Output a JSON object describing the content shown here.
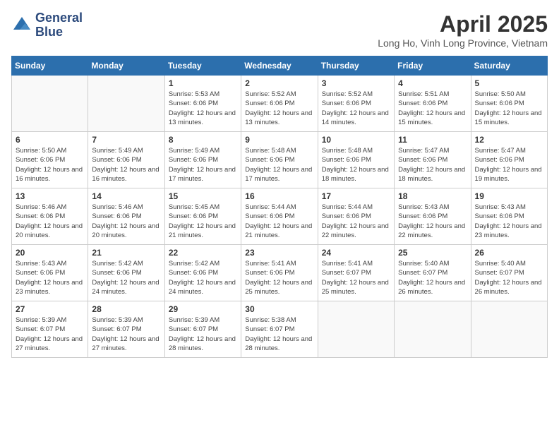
{
  "logo": {
    "line1": "General",
    "line2": "Blue"
  },
  "title": "April 2025",
  "location": "Long Ho, Vinh Long Province, Vietnam",
  "weekdays": [
    "Sunday",
    "Monday",
    "Tuesday",
    "Wednesday",
    "Thursday",
    "Friday",
    "Saturday"
  ],
  "weeks": [
    [
      {
        "day": "",
        "info": ""
      },
      {
        "day": "",
        "info": ""
      },
      {
        "day": "1",
        "info": "Sunrise: 5:53 AM\nSunset: 6:06 PM\nDaylight: 12 hours and 13 minutes."
      },
      {
        "day": "2",
        "info": "Sunrise: 5:52 AM\nSunset: 6:06 PM\nDaylight: 12 hours and 13 minutes."
      },
      {
        "day": "3",
        "info": "Sunrise: 5:52 AM\nSunset: 6:06 PM\nDaylight: 12 hours and 14 minutes."
      },
      {
        "day": "4",
        "info": "Sunrise: 5:51 AM\nSunset: 6:06 PM\nDaylight: 12 hours and 15 minutes."
      },
      {
        "day": "5",
        "info": "Sunrise: 5:50 AM\nSunset: 6:06 PM\nDaylight: 12 hours and 15 minutes."
      }
    ],
    [
      {
        "day": "6",
        "info": "Sunrise: 5:50 AM\nSunset: 6:06 PM\nDaylight: 12 hours and 16 minutes."
      },
      {
        "day": "7",
        "info": "Sunrise: 5:49 AM\nSunset: 6:06 PM\nDaylight: 12 hours and 16 minutes."
      },
      {
        "day": "8",
        "info": "Sunrise: 5:49 AM\nSunset: 6:06 PM\nDaylight: 12 hours and 17 minutes."
      },
      {
        "day": "9",
        "info": "Sunrise: 5:48 AM\nSunset: 6:06 PM\nDaylight: 12 hours and 17 minutes."
      },
      {
        "day": "10",
        "info": "Sunrise: 5:48 AM\nSunset: 6:06 PM\nDaylight: 12 hours and 18 minutes."
      },
      {
        "day": "11",
        "info": "Sunrise: 5:47 AM\nSunset: 6:06 PM\nDaylight: 12 hours and 18 minutes."
      },
      {
        "day": "12",
        "info": "Sunrise: 5:47 AM\nSunset: 6:06 PM\nDaylight: 12 hours and 19 minutes."
      }
    ],
    [
      {
        "day": "13",
        "info": "Sunrise: 5:46 AM\nSunset: 6:06 PM\nDaylight: 12 hours and 20 minutes."
      },
      {
        "day": "14",
        "info": "Sunrise: 5:46 AM\nSunset: 6:06 PM\nDaylight: 12 hours and 20 minutes."
      },
      {
        "day": "15",
        "info": "Sunrise: 5:45 AM\nSunset: 6:06 PM\nDaylight: 12 hours and 21 minutes."
      },
      {
        "day": "16",
        "info": "Sunrise: 5:44 AM\nSunset: 6:06 PM\nDaylight: 12 hours and 21 minutes."
      },
      {
        "day": "17",
        "info": "Sunrise: 5:44 AM\nSunset: 6:06 PM\nDaylight: 12 hours and 22 minutes."
      },
      {
        "day": "18",
        "info": "Sunrise: 5:43 AM\nSunset: 6:06 PM\nDaylight: 12 hours and 22 minutes."
      },
      {
        "day": "19",
        "info": "Sunrise: 5:43 AM\nSunset: 6:06 PM\nDaylight: 12 hours and 23 minutes."
      }
    ],
    [
      {
        "day": "20",
        "info": "Sunrise: 5:43 AM\nSunset: 6:06 PM\nDaylight: 12 hours and 23 minutes."
      },
      {
        "day": "21",
        "info": "Sunrise: 5:42 AM\nSunset: 6:06 PM\nDaylight: 12 hours and 24 minutes."
      },
      {
        "day": "22",
        "info": "Sunrise: 5:42 AM\nSunset: 6:06 PM\nDaylight: 12 hours and 24 minutes."
      },
      {
        "day": "23",
        "info": "Sunrise: 5:41 AM\nSunset: 6:06 PM\nDaylight: 12 hours and 25 minutes."
      },
      {
        "day": "24",
        "info": "Sunrise: 5:41 AM\nSunset: 6:07 PM\nDaylight: 12 hours and 25 minutes."
      },
      {
        "day": "25",
        "info": "Sunrise: 5:40 AM\nSunset: 6:07 PM\nDaylight: 12 hours and 26 minutes."
      },
      {
        "day": "26",
        "info": "Sunrise: 5:40 AM\nSunset: 6:07 PM\nDaylight: 12 hours and 26 minutes."
      }
    ],
    [
      {
        "day": "27",
        "info": "Sunrise: 5:39 AM\nSunset: 6:07 PM\nDaylight: 12 hours and 27 minutes."
      },
      {
        "day": "28",
        "info": "Sunrise: 5:39 AM\nSunset: 6:07 PM\nDaylight: 12 hours and 27 minutes."
      },
      {
        "day": "29",
        "info": "Sunrise: 5:39 AM\nSunset: 6:07 PM\nDaylight: 12 hours and 28 minutes."
      },
      {
        "day": "30",
        "info": "Sunrise: 5:38 AM\nSunset: 6:07 PM\nDaylight: 12 hours and 28 minutes."
      },
      {
        "day": "",
        "info": ""
      },
      {
        "day": "",
        "info": ""
      },
      {
        "day": "",
        "info": ""
      }
    ]
  ]
}
